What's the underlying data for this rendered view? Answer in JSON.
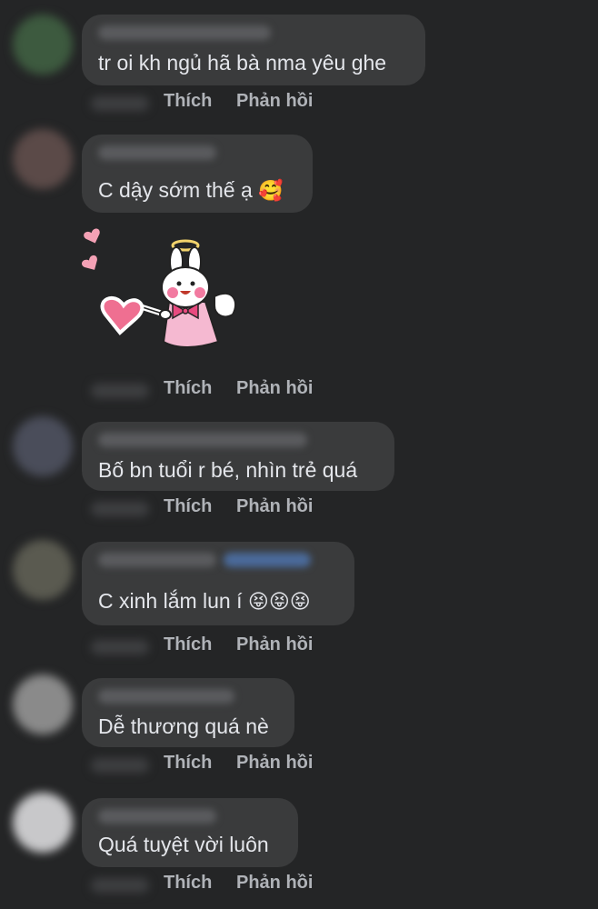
{
  "actions": {
    "like_label": "Thích",
    "reply_label": "Phản hồi"
  },
  "comments": [
    {
      "text": "tr oi kh ngủ hã bà nma yêu ghe"
    },
    {
      "text": "C dậy sớm thế ạ",
      "emoji": "🥰",
      "sticker": "angel-bunny-sticker"
    },
    {
      "text": "Bố bn tuổi r bé, nhìn trẻ quá"
    },
    {
      "text": "C xinh lắm lun í",
      "emoji": "😝😝😝"
    },
    {
      "text": "Dễ thương quá nè"
    },
    {
      "text": "Quá tuyệt vời luôn"
    }
  ],
  "colors": {
    "background": "#242526",
    "bubble": "#3a3b3c",
    "text": "#e4e6eb",
    "secondary_text": "#b0b3b8"
  }
}
